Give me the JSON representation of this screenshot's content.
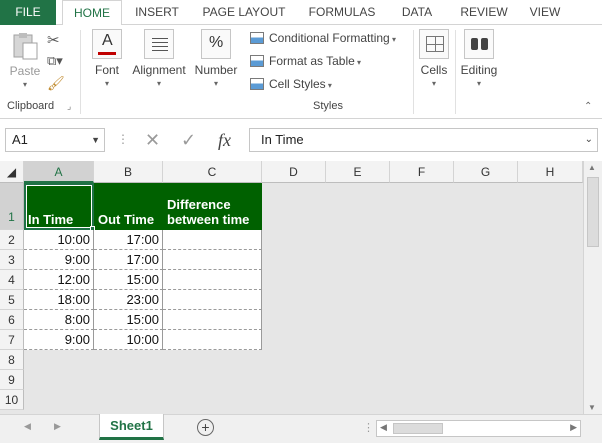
{
  "ribbon_tabs": [
    "FILE",
    "HOME",
    "INSERT",
    "PAGE LAYOUT",
    "FORMULAS",
    "DATA",
    "REVIEW",
    "VIEW"
  ],
  "clipboard": {
    "paste_label": "Paste",
    "group_label": "Clipboard"
  },
  "font_group": {
    "label": "Font"
  },
  "alignment_group": {
    "label": "Alignment"
  },
  "number_group": {
    "label": "Number",
    "icon_text": "%"
  },
  "styles": {
    "conditional_formatting": "Conditional Formatting",
    "format_as_table": "Format as Table",
    "cell_styles": "Cell Styles",
    "group_label": "Styles"
  },
  "cells_group": {
    "label": "Cells"
  },
  "editing_group": {
    "label": "Editing"
  },
  "formula_bar": {
    "name_box": "A1",
    "formula": "In Time",
    "fx": "fx"
  },
  "columns": [
    "A",
    "B",
    "C",
    "D",
    "E",
    "F",
    "G",
    "H"
  ],
  "rows": [
    "1",
    "2",
    "3",
    "4",
    "5",
    "6",
    "7",
    "8",
    "9",
    "10"
  ],
  "table": {
    "headers": [
      "In Time",
      "Out Time",
      "Difference between time"
    ],
    "rows": [
      [
        "10:00",
        "17:00",
        ""
      ],
      [
        "9:00",
        "17:00",
        ""
      ],
      [
        "12:00",
        "15:00",
        ""
      ],
      [
        "18:00",
        "23:00",
        ""
      ],
      [
        "8:00",
        "15:00",
        ""
      ],
      [
        "9:00",
        "10:00",
        ""
      ]
    ]
  },
  "sheet": {
    "tab_name": "Sheet1"
  },
  "colors": {
    "accent": "#217346",
    "header_fill": "#006100"
  }
}
